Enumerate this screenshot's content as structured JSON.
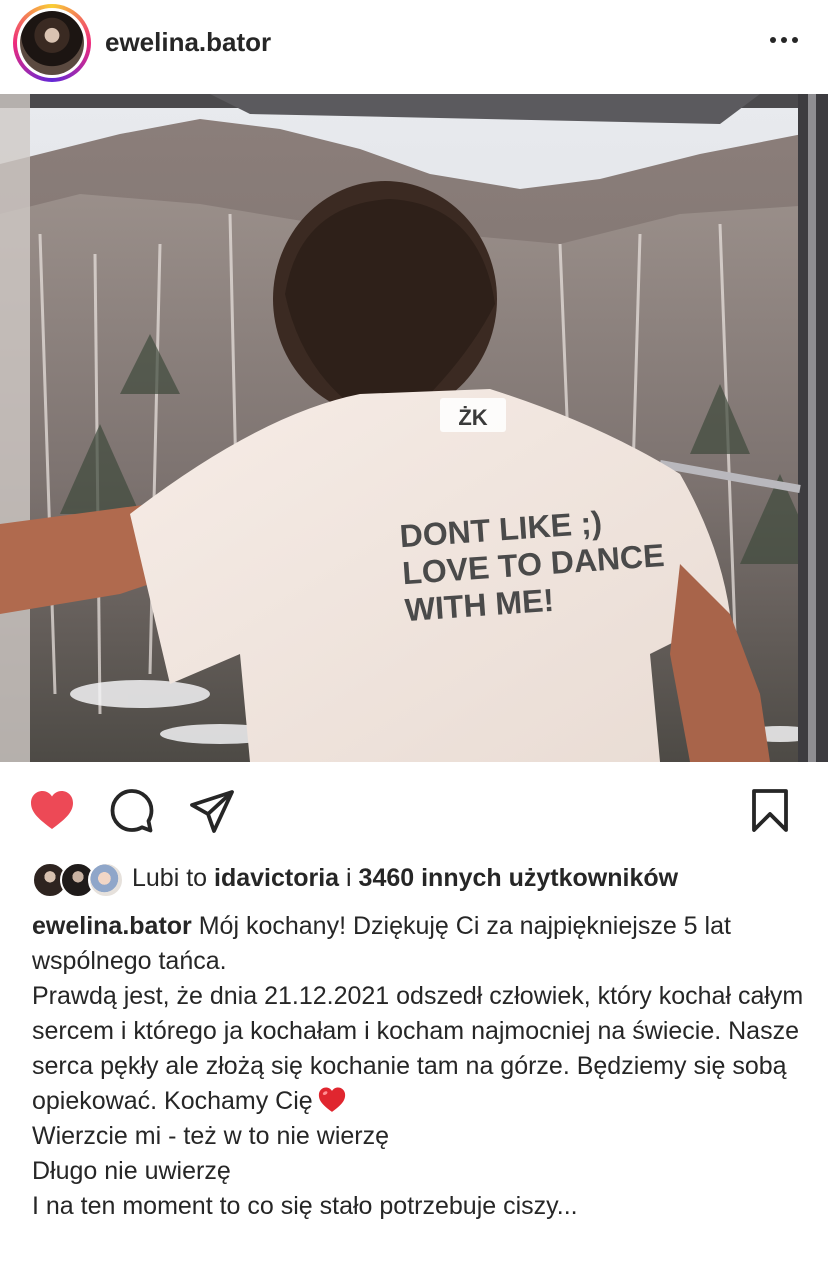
{
  "post": {
    "author": "ewelina.bator",
    "more_icon": "more-horizontal-icon"
  },
  "photo": {
    "shirt_logo": "ŻK",
    "shirt_lines": [
      "DONT LIKE ;)",
      "LOVE TO DANCE",
      "WITH ME!"
    ]
  },
  "actions": {
    "like_icon": "heart-filled-icon",
    "comment_icon": "comment-icon",
    "share_icon": "send-icon",
    "save_icon": "bookmark-icon",
    "like_color": "#ed4956"
  },
  "likes": {
    "prefix": "Lubi to",
    "user": "idavictoria",
    "joiner": "i",
    "others": "3460 innych użytkowników"
  },
  "caption": {
    "author": "ewelina.bator",
    "first": "Mój kochany! Dziękuję Ci za najpiękniejsze 5 lat wspólnego tańca.",
    "paragraph": "Prawdą jest, że dnia 21.12.2021 odszedł człowiek, który kochał całym sercem i którego ja kochałam i kocham najmocniej na świecie. Nasze serca pękły ale złożą się kochanie tam na górze. Będziemy się sobą opiekować. Kochamy Cię",
    "line3": "Wierzcie mi - też w to nie wierzę",
    "line4": "Długo nie uwierzę",
    "line5": "I na ten moment to co się stało potrzebuje ciszy..."
  }
}
